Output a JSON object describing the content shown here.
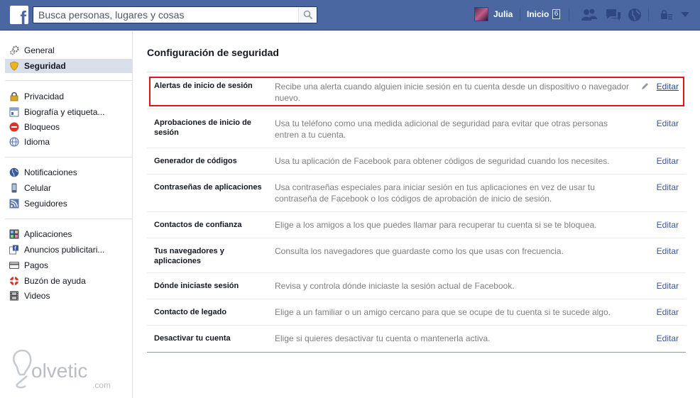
{
  "topbar": {
    "logo": "f",
    "search_placeholder": "Busca personas, lugares y cosas",
    "profile_name": "Julia",
    "home_label": "Inicio",
    "home_count": "6",
    "icons": [
      "friend-requests-icon",
      "messages-icon",
      "notifications-globe-icon",
      "privacy-shortcuts-icon",
      "account-menu-icon"
    ]
  },
  "sidebar": {
    "items": [
      {
        "label": "General",
        "icon": "gears-icon"
      },
      {
        "label": "Seguridad",
        "icon": "shield-icon"
      },
      {
        "label": "Privacidad",
        "icon": "lock-icon"
      },
      {
        "label": "Biografía y etiqueta...",
        "icon": "timeline-icon"
      },
      {
        "label": "Bloqueos",
        "icon": "block-icon"
      },
      {
        "label": "Idioma",
        "icon": "globe-icon"
      },
      {
        "label": "Notificaciones",
        "icon": "globe-notifications-icon"
      },
      {
        "label": "Celular",
        "icon": "phone-icon"
      },
      {
        "label": "Seguidores",
        "icon": "rss-icon"
      },
      {
        "label": "Aplicaciones",
        "icon": "apps-icon"
      },
      {
        "label": "Anuncios publicitari...",
        "icon": "ads-icon"
      },
      {
        "label": "Pagos",
        "icon": "payments-icon"
      },
      {
        "label": "Buzón de ayuda",
        "icon": "lifebuoy-icon"
      },
      {
        "label": "Videos",
        "icon": "film-icon"
      }
    ]
  },
  "main": {
    "title": "Configuración de seguridad",
    "edit_label": "Editar",
    "rows": [
      {
        "label": "Alertas de inicio de sesión",
        "desc": "Recibe una alerta cuando alguien inicie sesión en tu cuenta desde un dispositivo o navegador nuevo."
      },
      {
        "label": "Aprobaciones de inicio de sesión",
        "desc": "Usa tu teléfono como una medida adicional de seguridad para evitar que otras personas entren a tu cuenta."
      },
      {
        "label": "Generador de códigos",
        "desc": "Usa tu aplicación de Facebook para obtener códigos de seguridad cuando los necesites."
      },
      {
        "label": "Contraseñas de aplicaciones",
        "desc": "Usa contraseñas especiales para iniciar sesión en tus aplicaciones en vez de usar tu contraseña de Facebook o los códigos de aprobación de inicio de sesión."
      },
      {
        "label": "Contactos de confianza",
        "desc": "Elige a los amigos a los que puedes llamar para recuperar tu cuenta si se te bloquea."
      },
      {
        "label": "Tus navegadores y aplicaciones",
        "desc": "Consulta los navegadores que guardaste como los que usas con frecuencia."
      },
      {
        "label": "Dónde iniciaste sesión",
        "desc": "Revisa y controla dónde iniciaste la sesión actual de Facebook."
      },
      {
        "label": "Contacto de legado",
        "desc": "Elige a un familiar o un amigo cercano para que se ocupe de tu cuenta si te sucede algo."
      },
      {
        "label": "Desactivar tu cuenta",
        "desc": "Elige si quieres desactivar tu cuenta o mantenerla activa."
      }
    ]
  },
  "watermark": {
    "text": "olvetic",
    "suffix": ".com"
  },
  "colors": {
    "topbar": "#4b67a1",
    "link": "#3b5998",
    "highlight": "#e4141c",
    "active_item": "#d8dfea"
  }
}
